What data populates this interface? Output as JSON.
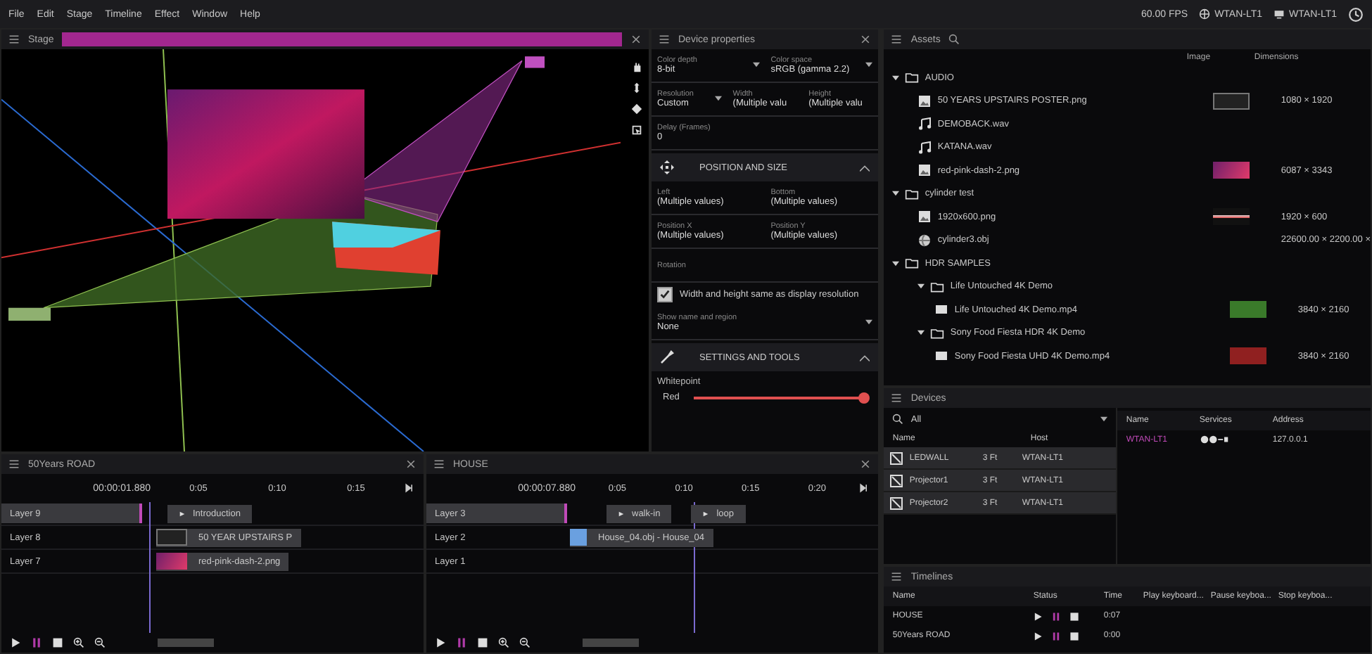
{
  "menu": [
    "File",
    "Edit",
    "Stage",
    "Timeline",
    "Effect",
    "Window",
    "Help"
  ],
  "status": {
    "fps": "60.00 FPS",
    "hosts": [
      {
        "kind": "network",
        "label": "WTAN-LT1"
      },
      {
        "kind": "display",
        "label": "WTAN-LT1"
      }
    ]
  },
  "stage": {
    "title": "Stage"
  },
  "properties": {
    "title": "Device properties",
    "rows": [
      [
        {
          "kind": "dropdown",
          "label": "Color depth",
          "value": "8-bit"
        },
        {
          "kind": "dropdown",
          "label": "Color space",
          "value": "sRGB (gamma 2.2)"
        }
      ],
      [
        {
          "kind": "dropdown",
          "label": "Resolution",
          "value": "Custom"
        },
        {
          "kind": "text",
          "label": "Width",
          "value": "(Multiple valu"
        },
        {
          "kind": "text",
          "label": "Height",
          "value": "(Multiple valu"
        }
      ],
      [
        {
          "kind": "text",
          "label": "Delay (Frames)",
          "value": "0"
        }
      ]
    ],
    "sections": [
      {
        "kind": "position",
        "title": "POSITION AND SIZE",
        "expanded": true,
        "rows": [
          [
            {
              "label": "Left",
              "value": "(Multiple values)"
            },
            {
              "label": "Bottom",
              "value": "(Multiple values)"
            }
          ],
          [
            {
              "label": "Position X",
              "value": "(Multiple values)"
            },
            {
              "label": "Position Y",
              "value": "(Multiple values)"
            }
          ],
          [
            {
              "label": "Rotation"
            }
          ]
        ],
        "checkbox": {
          "label": "Width and height same as display resolution",
          "checked": true
        },
        "dropdown": {
          "label": "Show name and region",
          "value": "None"
        }
      },
      {
        "kind": "settings",
        "title": "SETTINGS AND TOOLS",
        "expanded": true,
        "label": "Whitepoint",
        "slider": {
          "label": "Red",
          "level": 1.0
        }
      }
    ]
  },
  "assets": {
    "title": "Assets",
    "columns": [
      "Image",
      "Dimensions"
    ],
    "tree": [
      {
        "kind": "folder",
        "name": "AUDIO",
        "expanded": true,
        "children": [
          {
            "kind": "image",
            "name": "50 YEARS UPSTAIRS POSTER.png",
            "thumbnail": {
              "kind": "logo"
            },
            "dimensions": "1080 × 1920"
          },
          {
            "kind": "audio",
            "name": "DEMOBACK.wav"
          },
          {
            "kind": "audio",
            "name": "KATANA.wav"
          },
          {
            "kind": "image",
            "name": "red-pink-dash-2.png",
            "thumbnail": {
              "kind": "magenta"
            },
            "dimensions": "6087 × 3343"
          }
        ]
      },
      {
        "kind": "folder",
        "name": "cylinder test",
        "expanded": true,
        "children": [
          {
            "kind": "image",
            "name": "1920x600.png",
            "thumbnail": {
              "kind": "strip"
            },
            "dimensions": "1920 × 600"
          },
          {
            "kind": "mesh",
            "name": "cylinder3.obj",
            "dimensions": "22600.00 × 2200.00 ×"
          }
        ]
      },
      {
        "kind": "folder",
        "name": "HDR SAMPLES",
        "expanded": true,
        "children": [
          {
            "kind": "folder",
            "name": "Life Untouched 4K Demo",
            "expanded": true,
            "children": [
              {
                "kind": "video",
                "name": "Life Untouched 4K Demo.mp4",
                "thumbnail": {
                  "kind": "green"
                },
                "dimensions": "3840 × 2160"
              }
            ]
          },
          {
            "kind": "folder",
            "name": "Sony Food Fiesta HDR 4K Demo",
            "expanded": true,
            "children": [
              {
                "kind": "video",
                "name": "Sony Food Fiesta UHD 4K Demo.mp4",
                "thumbnail": {
                  "kind": "red"
                },
                "dimensions": "3840 × 2160"
              }
            ]
          }
        ]
      }
    ]
  },
  "devices": {
    "title": "Devices",
    "search": "All",
    "columns": [
      "Name",
      "Host"
    ],
    "rows": [
      {
        "name": "LEDWALL",
        "size": "3 Ft",
        "host": "WTAN-LT1"
      },
      {
        "name": "Projector1",
        "size": "3 Ft",
        "host": "WTAN-LT1"
      },
      {
        "name": "Projector2",
        "size": "3 Ft",
        "host": "WTAN-LT1"
      }
    ],
    "host_columns": [
      "Name",
      "Services",
      "Address"
    ],
    "hosts": [
      {
        "name": "WTAN-LT1",
        "address": "127.0.0.1"
      }
    ]
  },
  "timelines_list": {
    "title": "Timelines",
    "columns": [
      "Name",
      "Status",
      "Time",
      "Play keyboard...",
      "Pause keyboa...",
      "Stop keyboa..."
    ],
    "rows": [
      {
        "name": "HOUSE",
        "time": "0:07"
      },
      {
        "name": "50Years ROAD",
        "time": "0:00"
      }
    ]
  },
  "timelines": [
    {
      "title": "50Years ROAD",
      "time": "00:00:01.880",
      "ticks": [
        "0:05",
        "0:10",
        "0:15"
      ],
      "layers": [
        {
          "name": "Layer 9",
          "selected": true,
          "clips": [
            {
              "kind": "cue",
              "label": "Introduction"
            }
          ]
        },
        {
          "name": "Layer 8",
          "selected": false,
          "clips": [
            {
              "kind": "media",
              "thumbnail": {
                "kind": "logo"
              },
              "label": "50 YEAR UPSTAIRS P"
            }
          ]
        },
        {
          "name": "Layer 7",
          "selected": false,
          "clips": [
            {
              "kind": "media",
              "thumbnail": {
                "kind": "magenta"
              },
              "label": "red-pink-dash-2.png"
            }
          ]
        }
      ]
    },
    {
      "title": "HOUSE",
      "time": "00:00:07.880",
      "ticks": [
        "0:05",
        "0:10",
        "0:15",
        "0:20"
      ],
      "layers": [
        {
          "name": "Layer 3",
          "selected": true,
          "clips": [
            {
              "kind": "cue",
              "label": "walk-in"
            },
            {
              "kind": "cue",
              "label": "loop"
            }
          ]
        },
        {
          "name": "Layer 2",
          "selected": false,
          "clips": [
            {
              "kind": "media",
              "thumbnail": {
                "kind": "mesh"
              },
              "label": "House_04.obj - House_04"
            }
          ]
        },
        {
          "name": "Layer 1",
          "selected": false
        }
      ]
    }
  ]
}
